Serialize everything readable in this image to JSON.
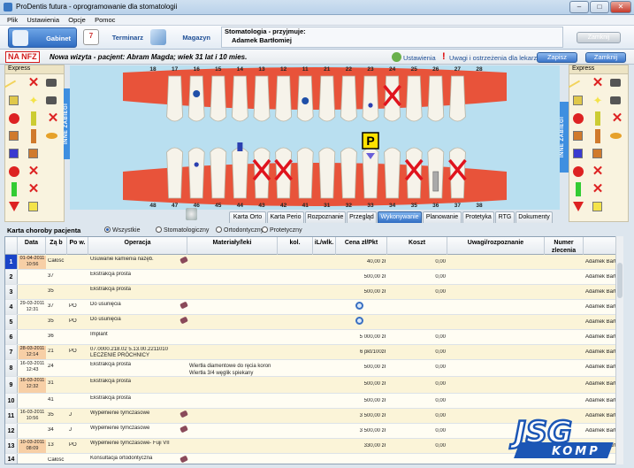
{
  "window": {
    "title": "ProDentis futura - oprogramowanie dla stomatologii",
    "min": "–",
    "max": "□",
    "close": "✕"
  },
  "menu": [
    "Plik",
    "Ustawienia",
    "Opcje",
    "Pomoc"
  ],
  "nav": {
    "gabinet": "Gabinet",
    "terminarz": "Terminarz",
    "magazyn": "Magazyn"
  },
  "stomatologia": {
    "label": "Stomatologia - przyjmuje:",
    "doctor": "Adamek Bartłomiej"
  },
  "zamknij_top": "Zamknij",
  "visit": {
    "nfz": "NA NFZ",
    "text": "Nowa wizyta - pacjent: Abram Magda; wiek 31 lat i 10 mies.",
    "ustawienia": "Ustawienia",
    "uwagi": "Uwagi i ostrzeżenia dla lekarza",
    "zapisz": "Zapisz",
    "zamknij": "Zamknij"
  },
  "panels": {
    "express": "Express",
    "inne_zabiegi": "INNE ZABIEGI"
  },
  "teeth": {
    "upper": [
      "18",
      "17",
      "16",
      "15",
      "14",
      "13",
      "12",
      "11",
      "21",
      "22",
      "23",
      "24",
      "25",
      "26",
      "27",
      "28"
    ],
    "lower": [
      "48",
      "47",
      "46",
      "45",
      "44",
      "43",
      "42",
      "41",
      "31",
      "32",
      "33",
      "34",
      "35",
      "36",
      "37",
      "38"
    ],
    "p_marker": "P"
  },
  "tabs": [
    "Karta Orto",
    "Karta Perio",
    "Rozpoznanie",
    "Przegląd",
    "Wykonywanie",
    "Planowanie",
    "Protetyka",
    "RTG",
    "Dokumenty"
  ],
  "selected_tab": "Wykonywanie",
  "karta": {
    "label": "Karta choroby pacjenta",
    "filters": [
      "Wszystkie",
      "Stomatologiczny",
      "Ortodontyczny",
      "Protetyczny"
    ],
    "selected_filter": "Wszystkie"
  },
  "grid": {
    "headers": [
      "Data",
      "Zą b",
      "Po w.",
      "Operacja",
      "Materiały/leki",
      "kol.",
      "iL/wlk.",
      "Cena zł/Pkt",
      "Koszt",
      "Uwagi/rozpoznanie",
      "Numer zlecenia",
      ""
    ],
    "rows": [
      {
        "n": "1",
        "date": "01-04-2011 10:56",
        "zab": "Całośc",
        "pow": "",
        "op": "Usuwanie kamienia nazęb.",
        "mat": "",
        "price": "40,00 zł",
        "cost": "0,00",
        "doc": "Adamek Bartłom"
      },
      {
        "n": "2",
        "date": "",
        "zab": "37",
        "pow": "",
        "op": "Ekstrakcja prosta",
        "mat": "",
        "price": "500,00 zł",
        "cost": "0,00",
        "doc": "Adamek Bartłom"
      },
      {
        "n": "3",
        "date": "",
        "zab": "35",
        "pow": "",
        "op": "Ekstrakcja prosta",
        "mat": "",
        "price": "500,00 zł",
        "cost": "0,00",
        "doc": "Adamek Bartłom"
      },
      {
        "n": "4",
        "date": "29-03-2011 12:31",
        "zab": "37",
        "pow": "PO",
        "op": "Do usunięcia",
        "mat": "",
        "price": "",
        "cost": "",
        "doc": "Adamek Bartłom"
      },
      {
        "n": "5",
        "date": "",
        "zab": "35",
        "pow": "PO",
        "op": "Do usunięcia",
        "mat": "",
        "price": "",
        "cost": "",
        "doc": "Adamek Bartłom"
      },
      {
        "n": "6",
        "date": "",
        "zab": "36",
        "pow": "",
        "op": "Implant",
        "mat": "",
        "price": "5 000,00 zł",
        "cost": "0,00",
        "doc": "Adamek Bartłom"
      },
      {
        "n": "7",
        "date": "28-03-2011 12:14",
        "zab": "21",
        "pow": "PO",
        "op": "07.0000.218.02 5.13.00.2211010 LECZENIE PRÓCHNICY",
        "mat": "",
        "price": "6 pkt/100zł",
        "cost": "0,00",
        "doc": "Adamek Bartłom"
      },
      {
        "n": "8",
        "date": "16-03-2011 12:43",
        "zab": "24",
        "pow": "",
        "op": "Ekstrakcja prosta",
        "mat": "Wiertła diamentowe do ręcia koron\nWiertła 3/4 węglik spiekany",
        "price": "500,00 zł",
        "cost": "0,00",
        "doc": "Adamek Bartłom"
      },
      {
        "n": "9",
        "date": "16-03-2011 12:32",
        "zab": "31",
        "pow": "",
        "op": "Ekstrakcja prosta",
        "mat": "",
        "price": "500,00 zł",
        "cost": "0,00",
        "doc": "Adamek Bartłom"
      },
      {
        "n": "10",
        "date": "",
        "zab": "41",
        "pow": "",
        "op": "Ekstrakcja prosta",
        "mat": "",
        "price": "500,00 zł",
        "cost": "0,00",
        "doc": "Adamek Bartłom"
      },
      {
        "n": "11",
        "date": "16-03-2011 10:56",
        "zab": "35",
        "pow": "J",
        "op": "Wypełnienie tymczasowe",
        "mat": "",
        "price": "3 500,00 zł",
        "cost": "0,00",
        "doc": "Adamek Bartłom"
      },
      {
        "n": "12",
        "date": "",
        "zab": "34",
        "pow": "J",
        "op": "Wypełnienie tymczasowe",
        "mat": "",
        "price": "3 500,00 zł",
        "cost": "0,00",
        "doc": "Adamek Bartłom"
      },
      {
        "n": "13",
        "date": "10-03-2011 08:09",
        "zab": "13",
        "pow": "PO",
        "op": "Wypełnienie tymczasowe- Fuji VII",
        "mat": "",
        "price": "330,00 zł",
        "cost": "0,00",
        "doc": "Adamek Bartłom"
      },
      {
        "n": "14",
        "date": "",
        "zab": "Całośc",
        "pow": "",
        "op": "Konsultacja ortodontyczna",
        "mat": "",
        "price": "",
        "cost": "",
        "doc": ""
      }
    ]
  },
  "logo": {
    "main": "JSG",
    "sub": "KOMP"
  },
  "colors": {
    "accent": "#2f6cc2",
    "gum": "#e8533a",
    "cross": "#e0141e",
    "selrow": "#1a44c8"
  }
}
